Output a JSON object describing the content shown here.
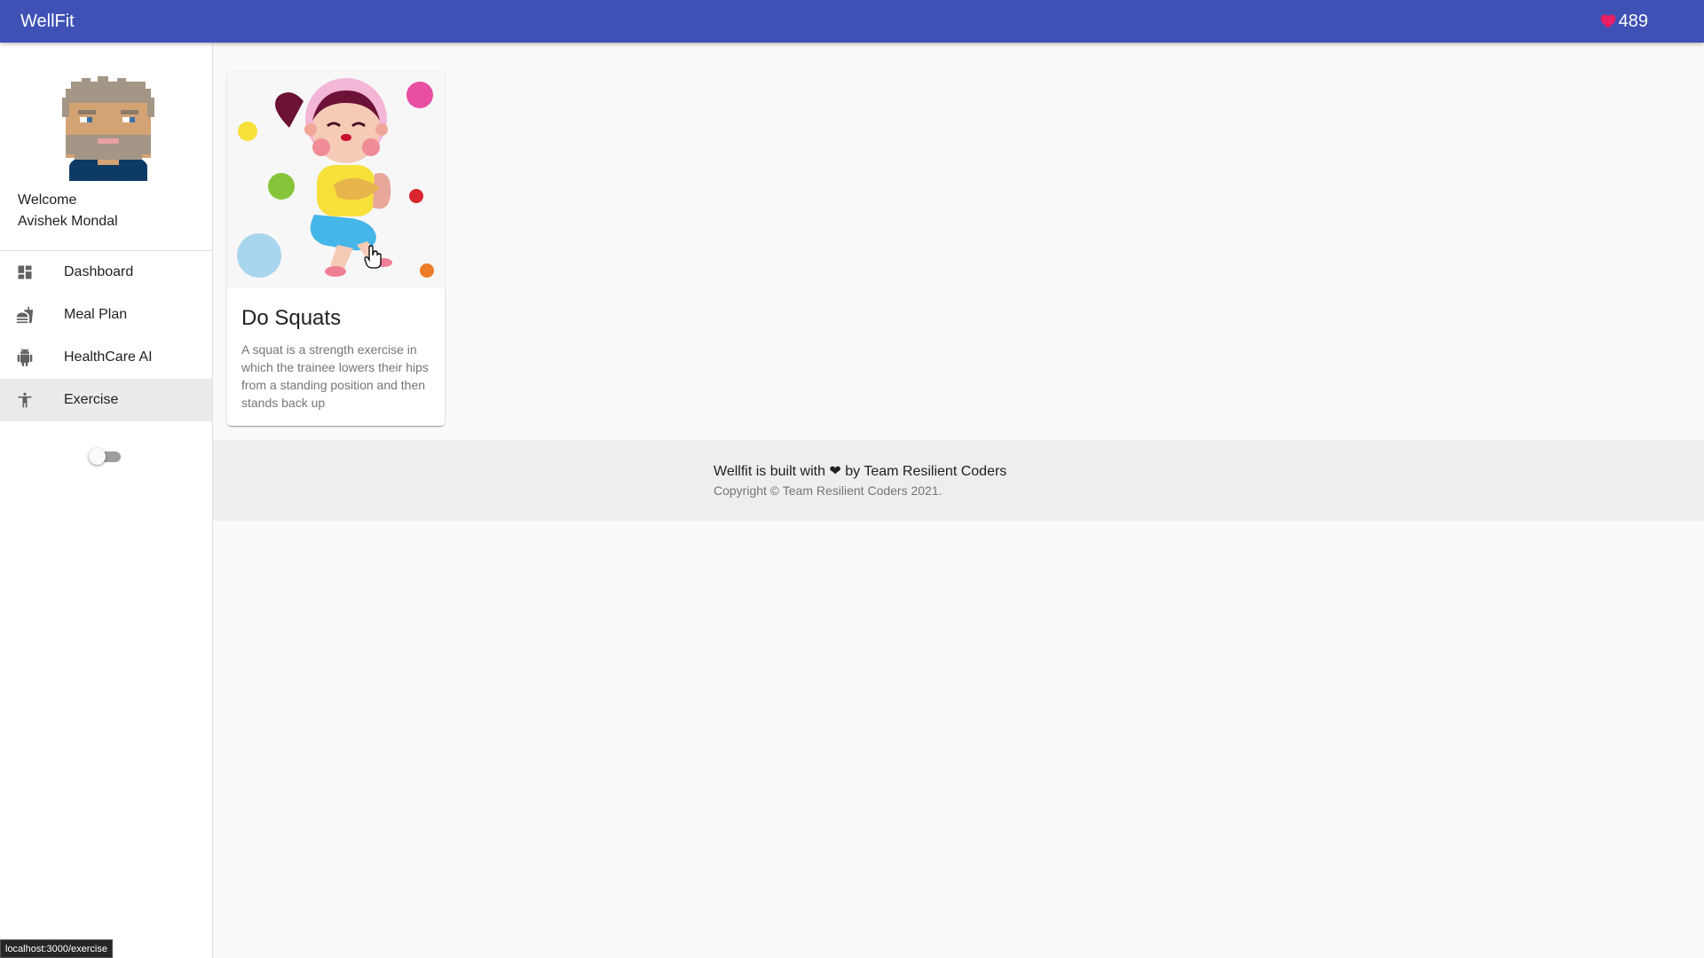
{
  "app": {
    "title": "WellFit",
    "heart_count": "489",
    "accent": "#3f51b5",
    "heart_color": "#e91e63"
  },
  "sidebar": {
    "welcome": "Welcome",
    "user_name": "Avishek Mondal",
    "items": [
      {
        "label": "Dashboard",
        "icon": "dashboard-icon",
        "active": false
      },
      {
        "label": "Meal Plan",
        "icon": "fastfood-icon",
        "active": false
      },
      {
        "label": "HealthCare AI",
        "icon": "android-icon",
        "active": false
      },
      {
        "label": "Exercise",
        "icon": "accessibility-icon",
        "active": true
      }
    ],
    "theme_toggle": {
      "checked": false
    }
  },
  "card": {
    "title": "Do Squats",
    "description": "A squat is a strength exercise in which the trainee lowers their hips from a standing position and then stands back up"
  },
  "footer": {
    "built_prefix": "Wellfit is built with",
    "built_suffix": "by Team Resilient Coders",
    "copyright": "Copyright © Team Resilient Coders 2021."
  },
  "status_bar": {
    "url": "localhost:3000/exercise"
  }
}
